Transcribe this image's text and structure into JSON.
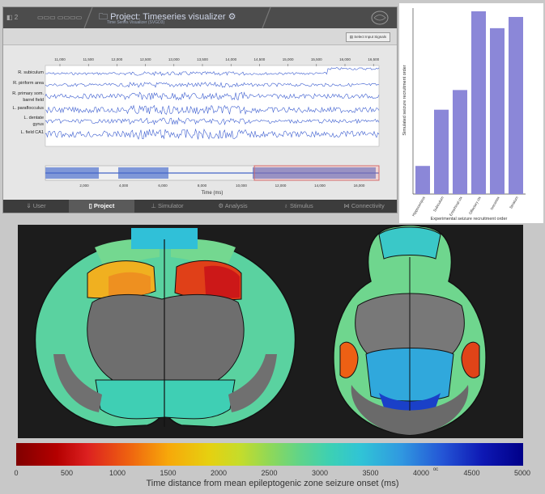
{
  "window": {
    "title": "Project: Timeseries visualizer",
    "subtitle": "Time Series Visualizer (SVGD3)",
    "select_button": "Select Input Signals"
  },
  "timeseries": {
    "channels": [
      "R. subiculum",
      "R. piriform area",
      "R. primary som.",
      "barrel field",
      "L. paraflocculus",
      "L. dentate",
      "gyrus",
      "L. field CA1"
    ],
    "top_ticks": [
      "11,000",
      "11,500",
      "12,000",
      "12,500",
      "13,000",
      "13,500",
      "14,000",
      "14,500",
      "15,000",
      "15,500",
      "16,000",
      "16,500"
    ],
    "bottom_ticks": [
      "2,000",
      "4,000",
      "6,000",
      "8,000",
      "10,000",
      "12,000",
      "14,000",
      "16,000"
    ],
    "xlabel": "Time (ms)"
  },
  "nav": [
    {
      "label": "User",
      "icon": "user-icon"
    },
    {
      "label": "Project",
      "icon": "document-icon"
    },
    {
      "label": "Simulator",
      "icon": "simulator-icon"
    },
    {
      "label": "Analysis",
      "icon": "gear-icon"
    },
    {
      "label": "Stimulus",
      "icon": "bulb-icon"
    },
    {
      "label": "Connectivity",
      "icon": "connectivity-icon"
    }
  ],
  "chart_data": {
    "type": "bar",
    "categories": [
      "Hippocampus",
      "Subiculum",
      "Entorhinal ctx",
      "Olfactory ctx",
      "Isocortex",
      "Striatum"
    ],
    "values": [
      1,
      3,
      3.7,
      6.5,
      5.9,
      6.3
    ],
    "ylim": [
      0,
      6.5
    ],
    "xlabel": "Experimental seizure recruitment order",
    "ylabel": "Simulated seizure recruitment order",
    "color": "#8b87d8"
  },
  "colorbar": {
    "ticks": [
      "0",
      "500",
      "1000",
      "1500",
      "2000",
      "2500",
      "3000",
      "3500",
      "4000",
      "4500",
      "5000"
    ],
    "label": "Time distance from mean epileptogenic zone seizure onset (ms)",
    "extra_mark": "oc"
  }
}
